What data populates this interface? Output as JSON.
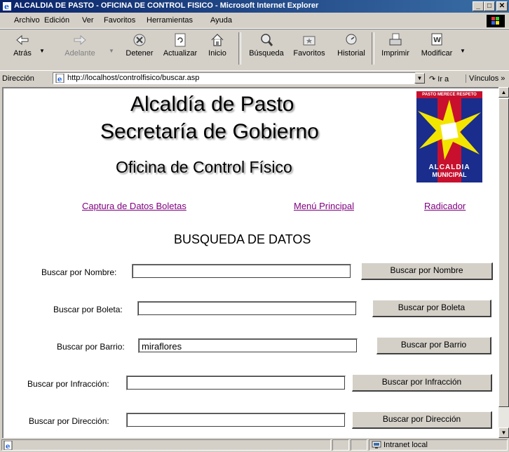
{
  "window": {
    "title": "ALCALDIA DE PASTO - OFICINA DE CONTROL FISICO - Microsoft Internet Explorer",
    "minimize": "_",
    "maximize": "□",
    "close": "✕"
  },
  "menu": [
    "Archivo",
    "Edición",
    "Ver",
    "Favoritos",
    "Herramientas",
    "Ayuda"
  ],
  "toolbar": {
    "back": "Atrás",
    "forward": "Adelante",
    "stop": "Detener",
    "refresh": "Actualizar",
    "home": "Inicio",
    "search": "Búsqueda",
    "favorites": "Favoritos",
    "history": "Historial",
    "print": "Imprimir",
    "edit": "Modificar"
  },
  "address": {
    "label": "Dirección",
    "url": "http://localhost/controlfisico/buscar.asp",
    "go": "Ir a",
    "links": "Vínculos »"
  },
  "page": {
    "heading1": "Alcaldía de Pasto",
    "heading2": "Secretaría de Gobierno",
    "heading3": "Oficina de Control Físico",
    "logo_top_text": "PASTO MERECE RESPETO",
    "logo_bottom_line1": "ALCALDIA",
    "logo_bottom_line2": "MUNICIPAL",
    "nav": {
      "captura": "Captura de Datos Boletas",
      "menu": "Menú Principal",
      "radicador": "Radicador"
    },
    "search_title": "BUSQUEDA DE DATOS",
    "fields": [
      {
        "label": "Buscar por Nombre:",
        "value": "",
        "button": "Buscar por Nombre"
      },
      {
        "label": "Buscar por Boleta:",
        "value": "",
        "button": "Buscar por Boleta"
      },
      {
        "label": "Buscar por Barrio:",
        "value": "miraflores",
        "button": "Buscar por Barrio"
      },
      {
        "label": "Buscar por Infracción:",
        "value": "",
        "button": "Buscar por Infracción"
      },
      {
        "label": "Buscar por Dirección:",
        "value": "",
        "button": "Buscar por Dirección"
      }
    ]
  },
  "status": {
    "zone": "Intranet local"
  },
  "colors": {
    "titlebar_start": "#0a246a",
    "titlebar_end": "#3a6ea5",
    "chrome": "#d4d0c8",
    "visited_link": "#800080",
    "logo_blue": "#1a2d8c",
    "logo_red": "#c8102e",
    "logo_yellow": "#f2e600"
  }
}
